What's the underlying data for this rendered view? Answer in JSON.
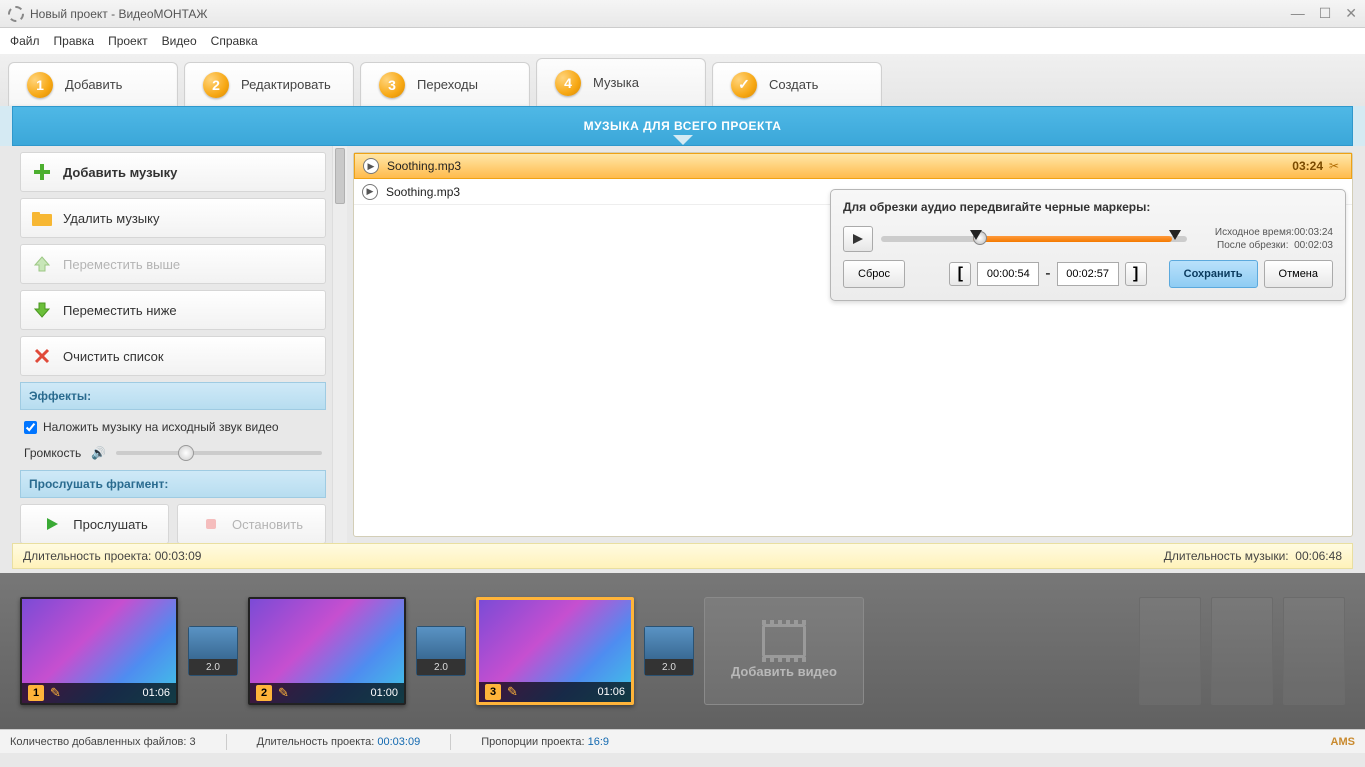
{
  "window": {
    "title": "Новый проект - ВидеоМОНТАЖ"
  },
  "menu": [
    "Файл",
    "Правка",
    "Проект",
    "Видео",
    "Справка"
  ],
  "tabs": [
    {
      "num": "1",
      "label": "Добавить"
    },
    {
      "num": "2",
      "label": "Редактировать"
    },
    {
      "num": "3",
      "label": "Переходы"
    },
    {
      "num": "4",
      "label": "Музыка"
    },
    {
      "num": "",
      "label": "Создать",
      "check": true
    }
  ],
  "active_tab": 3,
  "banner": "МУЗЫКА ДЛЯ ВСЕГО ПРОЕКТА",
  "sidebar": {
    "add_music": "Добавить музыку",
    "remove_music": "Удалить музыку",
    "move_up": "Переместить выше",
    "move_down": "Переместить ниже",
    "clear_list": "Очистить список",
    "effects_header": "Эффекты:",
    "overlay_label": "Наложить музыку на исходный звук видео",
    "volume_label": "Громкость",
    "volume_pct": 30,
    "preview_header": "Прослушать фрагмент:",
    "play_label": "Прослушать",
    "stop_label": "Остановить"
  },
  "tracks": [
    {
      "name": "Soothing.mp3",
      "duration": "03:24",
      "selected": true
    },
    {
      "name": "Soothing.mp3",
      "duration": "",
      "selected": false
    }
  ],
  "trim": {
    "hint": "Для обрезки аудио передвигайте черные маркеры:",
    "orig_label": "Исходное время:",
    "orig_value": "00:03:24",
    "after_label": "После обрезки:",
    "after_value": "00:02:03",
    "reset": "Сброс",
    "from": "00:00:54",
    "to": "00:02:57",
    "save": "Сохранить",
    "cancel": "Отмена",
    "dash": "-"
  },
  "status": {
    "project_label": "Длительность проекта:",
    "project_value": "00:03:09",
    "music_label": "Длительность музыки:",
    "music_value": "00:06:48"
  },
  "timeline": {
    "clips": [
      {
        "n": "1",
        "dur": "01:06"
      },
      {
        "n": "2",
        "dur": "01:00"
      },
      {
        "n": "3",
        "dur": "01:06",
        "selected": true
      }
    ],
    "transition_label": "2.0",
    "add_label": "Добавить видео"
  },
  "footer": {
    "files_label": "Количество добавленных файлов:",
    "files_value": "3",
    "dur_label": "Длительность проекта:",
    "dur_value": "00:03:09",
    "aspect_label": "Пропорции проекта:",
    "aspect_value": "16:9",
    "logo": "AMS"
  }
}
